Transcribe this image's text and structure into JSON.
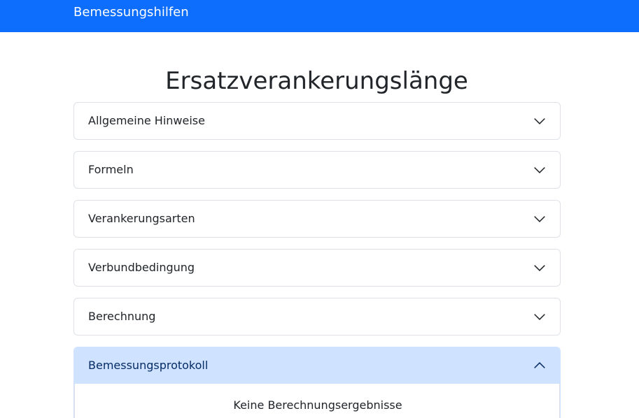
{
  "navbar": {
    "brand": "Bemessungshilfen"
  },
  "page": {
    "title": "Ersatzverankerungslänge"
  },
  "accordion": {
    "items": [
      {
        "label": "Allgemeine Hinweise",
        "expanded": false
      },
      {
        "label": "Formeln",
        "expanded": false
      },
      {
        "label": "Verankerungsarten",
        "expanded": false
      },
      {
        "label": "Verbundbedingung",
        "expanded": false
      },
      {
        "label": "Berechnung",
        "expanded": false
      },
      {
        "label": "Bemessungsprotokoll",
        "expanded": true,
        "body": "Keine Berechnungsergebnisse"
      }
    ]
  },
  "icons": {
    "collapsed": "chevron-down-icon",
    "expanded": "chevron-up-icon"
  },
  "colors": {
    "brand": "#0d6efd",
    "active_header": "#cfe2ff",
    "active_text": "#052c65"
  }
}
